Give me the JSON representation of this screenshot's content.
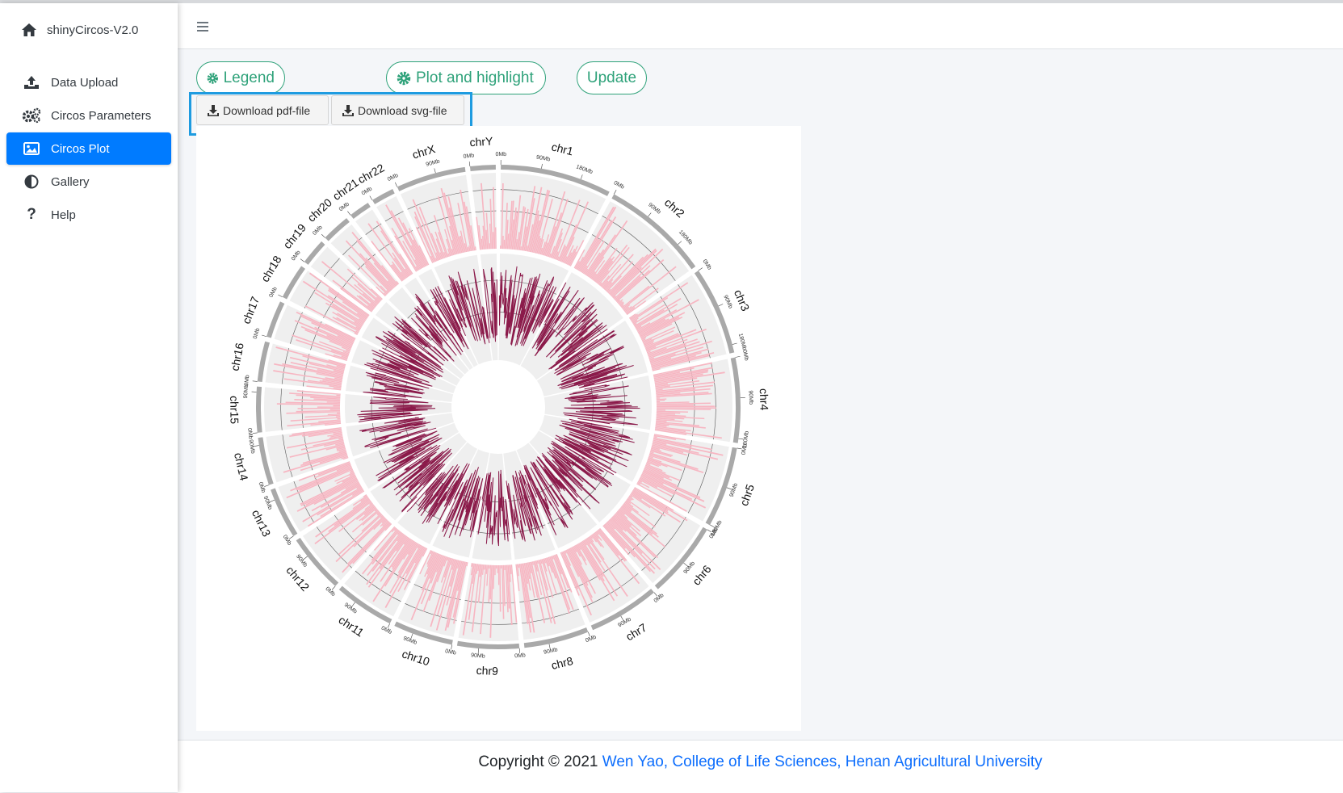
{
  "app": {
    "title": "shinyCircos-V2.0"
  },
  "sidebar": {
    "items": [
      {
        "label": "Data Upload",
        "icon": "upload-icon",
        "active": false
      },
      {
        "label": "Circos Parameters",
        "icon": "gears-icon",
        "active": false
      },
      {
        "label": "Circos Plot",
        "icon": "image-icon",
        "active": true
      },
      {
        "label": "Gallery",
        "icon": "half-circle-icon",
        "active": false
      },
      {
        "label": "Help",
        "icon": "question-icon",
        "active": false
      }
    ]
  },
  "toolbar": {
    "legend_label": "Legend",
    "plot_highlight_label": "Plot and highlight",
    "update_label": "Update",
    "download_pdf_label": "Download pdf-file",
    "download_svg_label": "Download svg-file"
  },
  "chart_data": {
    "type": "circos",
    "chromosomes": [
      "chr1",
      "chr2",
      "chr3",
      "chr4",
      "chr5",
      "chr6",
      "chr7",
      "chr8",
      "chr9",
      "chr10",
      "chr11",
      "chr12",
      "chr13",
      "chr14",
      "chr15",
      "chr16",
      "chr17",
      "chr18",
      "chr19",
      "chr20",
      "chr21",
      "chr22",
      "chrX",
      "chrY"
    ],
    "lengths_mb": [
      249,
      242,
      198,
      190,
      181,
      171,
      159,
      145,
      138,
      134,
      135,
      133,
      114,
      107,
      102,
      90,
      83,
      80,
      59,
      64,
      47,
      51,
      156,
      57
    ],
    "tick_labels": [
      "0Mb",
      "90Mb",
      "180Mb"
    ],
    "tracks": [
      {
        "type": "histogram",
        "color": "#f7b6c2"
      },
      {
        "type": "line",
        "color": "#8b1a4a"
      }
    ],
    "background_color": "#efefef",
    "ideogram_color": "#a9a9a9"
  },
  "footer": {
    "copyright": "Copyright © 2021",
    "link_text": "Wen Yao, College of Life Sciences, Henan Agricultural University"
  }
}
